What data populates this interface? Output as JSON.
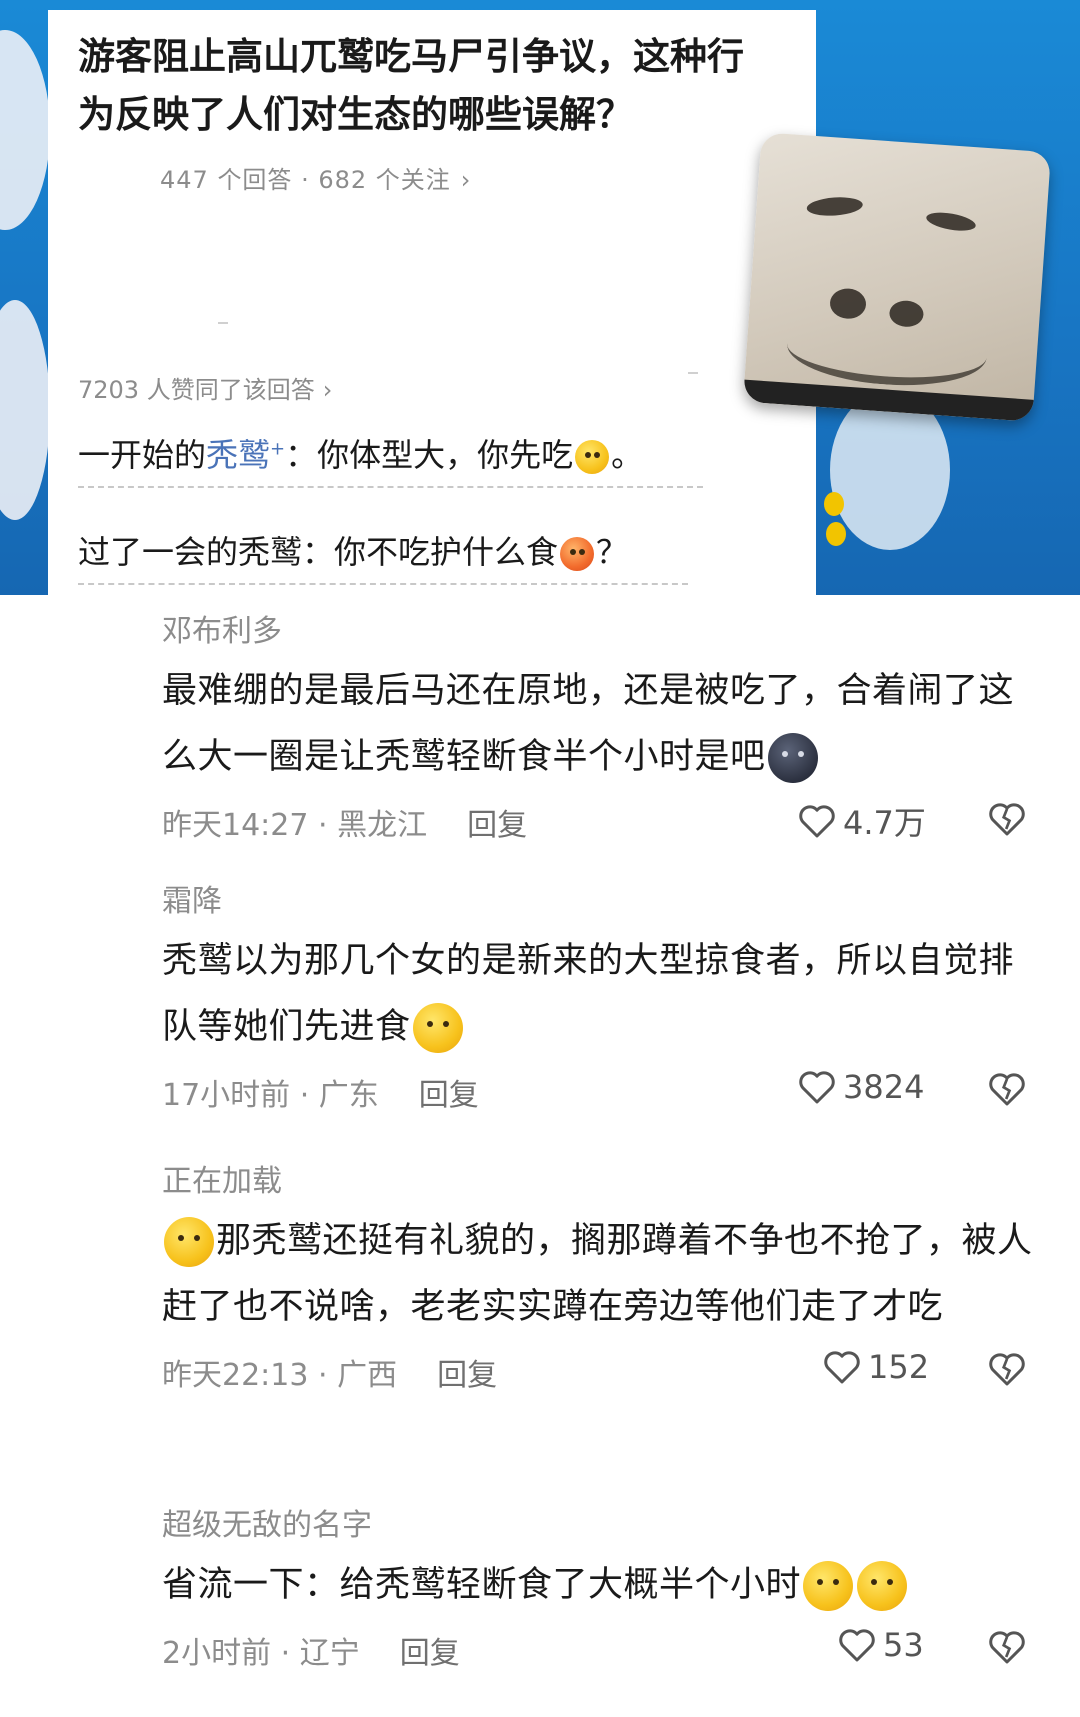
{
  "embedded": {
    "question_title": "游客阻止高山兀鹫吃马尸引争议，这种行为反映了人们对生态的哪些误解？",
    "question_meta": "447 个回答 · 682 个关注",
    "upvote_text": "7203 人赞同了该回答",
    "answer_line1": {
      "prefix": "一开始的",
      "highlight": "秃鹫",
      "sup": "+",
      "rest": "：你体型大，你先吃",
      "emoji": "loudly-crying-face",
      "end": "。"
    },
    "answer_line2": {
      "text": "过了一会的秃鹫：你不吃护什么食",
      "emoji": "angry-face",
      "end": "？"
    }
  },
  "comments": [
    {
      "user": "邓布利多",
      "text": "最难绷的是最后马还在原地，还是被吃了，合着闹了这么大一圈是让秃鹫轻断食半个小时是吧",
      "emoji": "new-moon-face",
      "time": "昨天14:27 · 黑龙江",
      "reply": "回复",
      "likes": "4.7万"
    },
    {
      "user": "霜降",
      "text": "秃鹫以为那几个女的是新来的大型掠食者，所以自觉排队等她们先进食",
      "emoji": "rolling-on-floor-laughing",
      "time": "17小时前 · 广东",
      "reply": "回复",
      "likes": "3824"
    },
    {
      "user": "正在加载",
      "text": "那秃鹫还挺有礼貌的，搁那蹲着不争也不抢了，被人赶了也不说啥，老老实实蹲在旁边等他们走了才吃",
      "emoji": "grinning-sweat-face",
      "time": "昨天22:13 · 广西",
      "reply": "回复",
      "likes": "152"
    },
    {
      "user": "超级无敌的名字",
      "text": "省流一下：给秃鹫轻断食了大概半个小时",
      "emoji": "rolling-on-floor-laughing ok-hand",
      "time": "2小时前 · 辽宁",
      "reply": "回复",
      "likes": "53"
    }
  ],
  "colors": {
    "background_blue": "#1876c4",
    "highlight_blue": "#4a73b8",
    "meta_gray": "#8c8c8c"
  }
}
